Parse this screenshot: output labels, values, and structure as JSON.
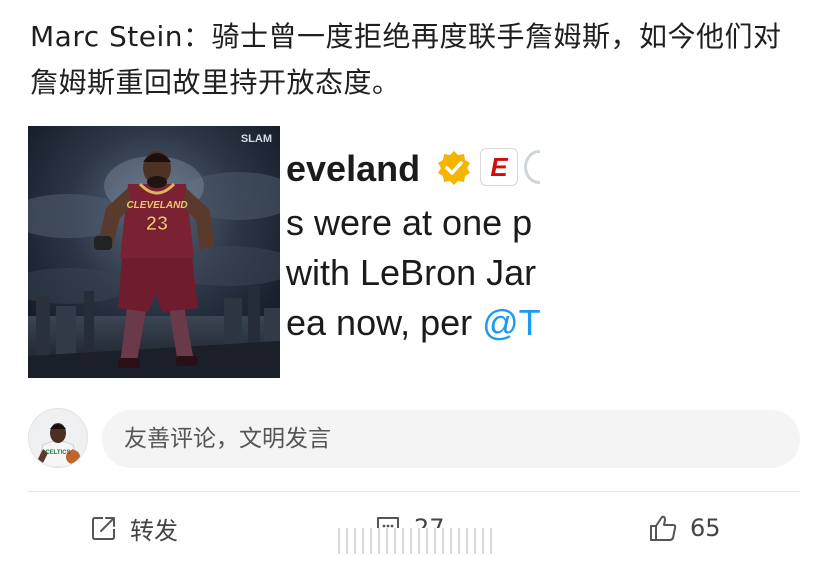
{
  "post": {
    "text": "Marc Stein：骑士曾一度拒绝再度联手詹姆斯，如今他们对詹姆斯重回故里持开放态度。"
  },
  "poster": {
    "watermark": "SLAM",
    "jersey_team": "CLEVELAND",
    "jersey_number": "23"
  },
  "tweet": {
    "name_fragment": "eveland",
    "lines": [
      "s were at one p",
      "with LeBron Jar",
      "ea now, per "
    ],
    "mention_fragment": "@T",
    "espn_glyph": "E",
    "colors": {
      "mention": "#1d9bf0",
      "badge": "#f5b400",
      "espn": "#d50a0a"
    }
  },
  "comment_box": {
    "placeholder": "友善评论，文明发言",
    "avatar_jersey": "CELTICS"
  },
  "actions": {
    "repost_label": "转发",
    "comment_count": "27",
    "like_count": "65"
  },
  "icons": {
    "repost": "share-out-icon",
    "comment": "comment-bubble-icon",
    "like": "thumbs-up-icon"
  }
}
